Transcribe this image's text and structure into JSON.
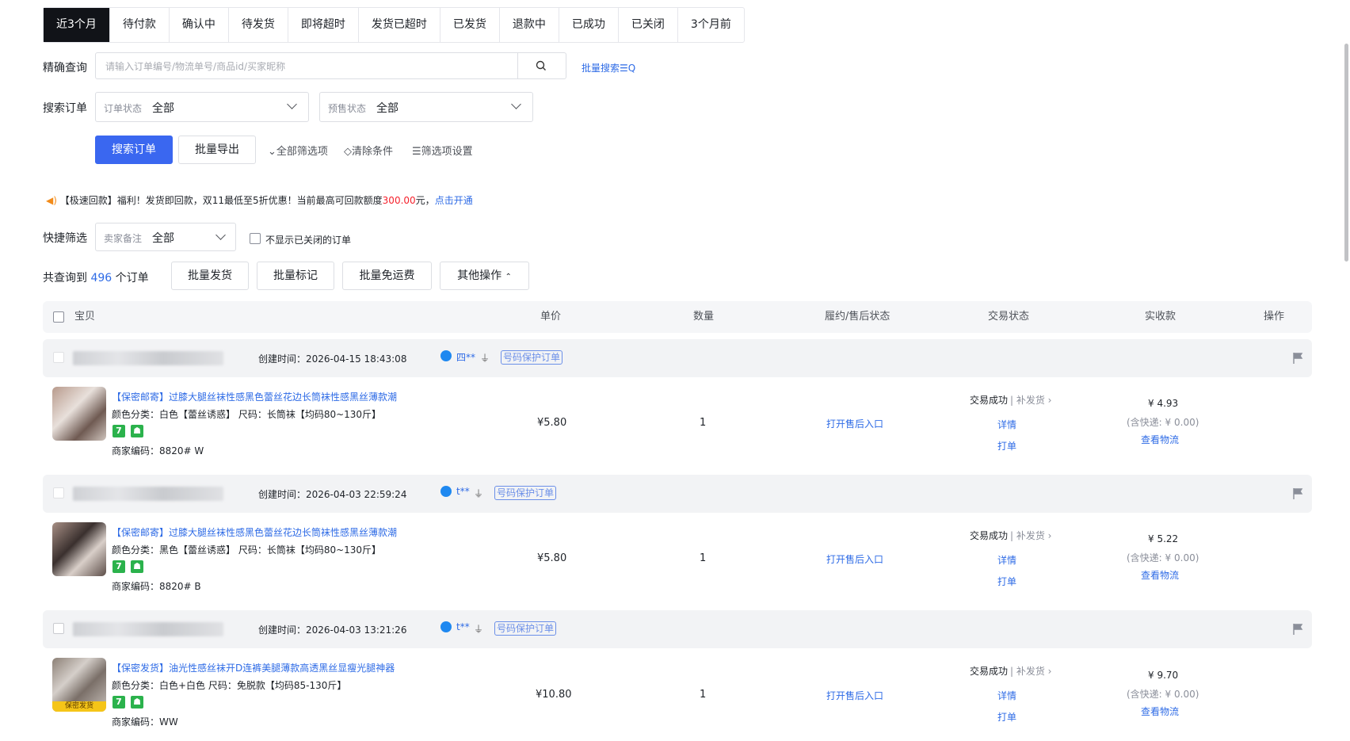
{
  "tabs": [
    "近3个月",
    "待付款",
    "确认中",
    "待发货",
    "即将超时",
    "发货已超时",
    "已发货",
    "退款中",
    "已成功",
    "已关闭",
    "3个月前"
  ],
  "precise": {
    "label": "精确查询",
    "placeholder": "请输入订单编号/物流单号/商品id/买家昵称",
    "batch_search": "批量搜索☰Q"
  },
  "search_orders": {
    "label": "搜索订单",
    "order_status": {
      "label": "订单状态",
      "value": "全部"
    },
    "presale_status": {
      "label": "预售状态",
      "value": "全部"
    }
  },
  "actions": {
    "search": "搜索订单",
    "export": "批量导出",
    "all_filters": "全部筛选项",
    "clear": "清除条件",
    "filter_settings": "筛选项设置"
  },
  "notice": {
    "prefix": "【极速回款】福利！发货即回款，双11最低至5折优惠！当前最高可回款额度",
    "amount": "300.00",
    "suffix": "元，",
    "link": "点击开通"
  },
  "quick_filter": {
    "label": "快捷筛选",
    "note_label": "卖家备注",
    "note_value": "全部",
    "hide_closed": "不显示已关闭的订单"
  },
  "summary": {
    "prefix": "共查询到",
    "count": "496",
    "suffix": "个订单"
  },
  "bulk": {
    "ship": "批量发货",
    "mark": "批量标记",
    "free_shipping": "批量免运费",
    "other": "其他操作"
  },
  "table_headers": {
    "item": "宝贝",
    "price": "单价",
    "qty": "数量",
    "after_sale": "履约/售后状态",
    "trade": "交易状态",
    "received": "实收款",
    "ops": "操作"
  },
  "orders": [
    {
      "created": "创建时间：2026-04-15 18:43:08",
      "buyer": "四**",
      "protect": "号码保护订单",
      "title": "【保密邮寄】过膝大腿丝袜性感黑色蕾丝花边长筒袜性感黑丝薄款潮",
      "spec": "颜色分类：白色【蕾丝诱惑】  尺码：长筒袜【均码80~130斤】",
      "code": "商家编码：8820# W",
      "price": "¥5.80",
      "qty": "1",
      "after_sale": "打开售后入口",
      "trade_status": "交易成功",
      "supplement": "补发货 ›",
      "detail": "详情",
      "print": "打单",
      "received": "¥ 4.93",
      "postage": "(含快递: ¥ 0.00)",
      "logistics": "查看物流"
    },
    {
      "created": "创建时间：2026-04-03 22:59:24",
      "buyer": "t**",
      "protect": "号码保护订单",
      "title": "【保密邮寄】过膝大腿丝袜性感黑色蕾丝花边长筒袜性感黑丝薄款潮",
      "spec": "颜色分类：黑色【蕾丝诱惑】  尺码：长筒袜【均码80~130斤】",
      "code": "商家编码：8820# B",
      "price": "¥5.80",
      "qty": "1",
      "after_sale": "打开售后入口",
      "trade_status": "交易成功",
      "supplement": "补发货 ›",
      "detail": "详情",
      "print": "打单",
      "received": "¥ 5.22",
      "postage": "(含快递: ¥ 0.00)",
      "logistics": "查看物流"
    },
    {
      "created": "创建时间：2026-04-03 13:21:26",
      "buyer": "t**",
      "protect": "号码保护订单",
      "title": "【保密发货】油光性感丝袜开D连裤美腿薄款高透黑丝显瘦光腿神器",
      "spec": "颜色分类：白色+白色  尺码：免脱款【均码85-130斤】",
      "code": "商家编码：WW",
      "price": "¥10.80",
      "qty": "1",
      "after_sale": "打开售后入口",
      "trade_status": "交易成功",
      "supplement": "补发货 ›",
      "detail": "详情",
      "print": "打单",
      "received": "¥ 9.70",
      "postage": "(含快递: ¥ 0.00)",
      "logistics": "查看物流",
      "thumb_tag": "保密发货"
    }
  ],
  "badges": {
    "seven_days": "7"
  }
}
